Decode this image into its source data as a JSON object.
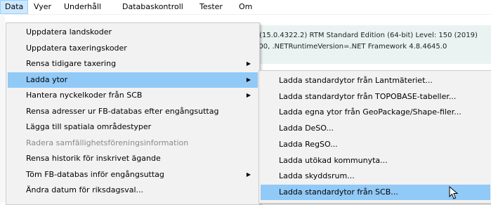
{
  "menubar": {
    "items": [
      "Data",
      "Vyer",
      "Underhåll",
      "Databaskontroll",
      "Tester",
      "Om"
    ]
  },
  "background": {
    "line1": ") (15.0.4322.2) RTM Standard Edition (64-bit) Level: 150 (2019)",
    "line2": "000, .NETRuntimeVersion=.NET Framework 4.8.4645.0"
  },
  "data_menu": {
    "items": [
      {
        "label": "Uppdatera landskoder",
        "submenu": false,
        "disabled": false,
        "highlighted": false
      },
      {
        "label": "Uppdatera taxeringskoder",
        "submenu": false,
        "disabled": false,
        "highlighted": false
      },
      {
        "label": "Rensa tidigare taxering",
        "submenu": true,
        "disabled": false,
        "highlighted": false
      },
      {
        "label": "Ladda ytor",
        "submenu": true,
        "disabled": false,
        "highlighted": true
      },
      {
        "label": "Hantera nyckelkoder från SCB",
        "submenu": true,
        "disabled": false,
        "highlighted": false
      },
      {
        "label": "Rensa adresser ur FB-databas efter engångsuttag",
        "submenu": false,
        "disabled": false,
        "highlighted": false
      },
      {
        "label": "Lägga till spatiala områdestyper",
        "submenu": false,
        "disabled": false,
        "highlighted": false
      },
      {
        "label": "Radera samfällighetsföreningsinformation",
        "submenu": false,
        "disabled": true,
        "highlighted": false
      },
      {
        "label": "Rensa historik för inskrivet ägande",
        "submenu": false,
        "disabled": false,
        "highlighted": false
      },
      {
        "label": "Töm FB-databas inför engångsuttag",
        "submenu": true,
        "disabled": false,
        "highlighted": false
      },
      {
        "label": "Ändra datum för riksdagsval...",
        "submenu": false,
        "disabled": false,
        "highlighted": false
      }
    ],
    "arrow_glyph": "▶"
  },
  "ladda_ytor_submenu": {
    "items": [
      {
        "label": "Ladda standardytor från Lantmäteriet...",
        "highlighted": false
      },
      {
        "label": "Ladda standardytor från TOPOBASE-tabeller...",
        "highlighted": false
      },
      {
        "label": "Ladda egna ytor från GeoPackage/Shape-filer...",
        "highlighted": false
      },
      {
        "label": "Ladda DeSO...",
        "highlighted": false
      },
      {
        "label": "Ladda RegSO...",
        "highlighted": false
      },
      {
        "label": "Ladda utökad kommunyta...",
        "highlighted": false
      },
      {
        "label": "Ladda skyddsrum...",
        "highlighted": false
      },
      {
        "label": "Ladda standardytor från SCB...",
        "highlighted": true
      }
    ]
  },
  "colors": {
    "menu_bg": "#f2f2f2",
    "highlight": "#91c9f7",
    "menubar_active": "#cce8ff"
  }
}
